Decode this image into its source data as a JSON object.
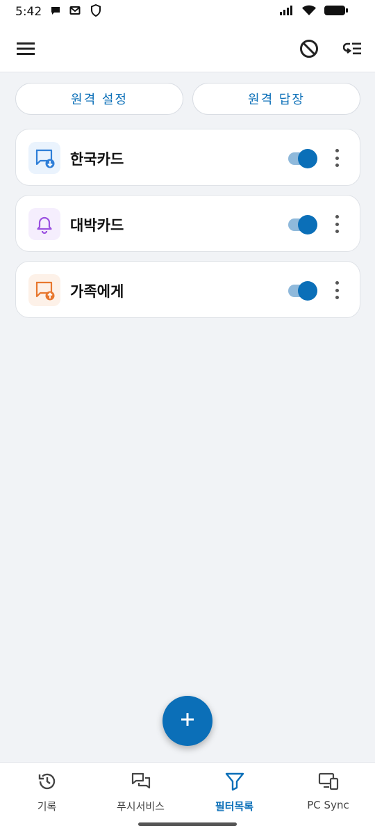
{
  "status_bar": {
    "time": "5:42",
    "left_icons": [
      "chat-bubble-icon",
      "mail-forward-icon",
      "shield-icon"
    ],
    "right_icons": [
      "signal-icon",
      "wifi-icon",
      "battery-icon"
    ]
  },
  "app_bar": {
    "menu_icon": "hamburger-menu-icon",
    "actions": [
      "block-icon",
      "reorder-list-icon"
    ]
  },
  "top_buttons": {
    "remote_settings": "원격 설정",
    "remote_reply": "원격 답장"
  },
  "filters": [
    {
      "name": "한국카드",
      "icon": "message-incoming-icon",
      "enabled": true,
      "color": "#2f7fd8",
      "tile": "#eaf3fd"
    },
    {
      "name": "대박카드",
      "icon": "bell-icon",
      "enabled": true,
      "color": "#9b51e0",
      "tile": "#f5eefd"
    },
    {
      "name": "가족에게",
      "icon": "message-outgoing-icon",
      "enabled": true,
      "color": "#e8772e",
      "tile": "#fdf1e8"
    }
  ],
  "fab": {
    "icon": "plus-icon"
  },
  "bottom_nav": [
    {
      "label": "기록",
      "icon": "history-icon",
      "active": false
    },
    {
      "label": "푸시서비스",
      "icon": "chat-bubbles-icon",
      "active": false
    },
    {
      "label": "필터목록",
      "icon": "filter-icon",
      "active": true
    },
    {
      "label": "PC Sync",
      "icon": "devices-icon",
      "active": false
    }
  ],
  "colors": {
    "accent": "#0b6fb8",
    "background": "#f1f3f6",
    "surface": "#ffffff"
  }
}
